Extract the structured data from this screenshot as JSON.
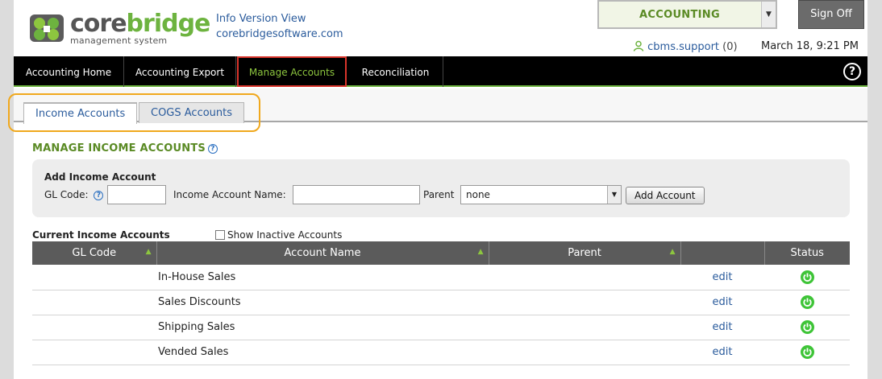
{
  "header": {
    "logo_core": "core",
    "logo_bridge": "bridge",
    "logo_sub": "management system",
    "link_info": "Info Version View",
    "link_site": "corebridgesoftware.com",
    "module": "ACCOUNTING",
    "signoff": "Sign Off",
    "username": "cbms.support",
    "user_count": "(0)",
    "datetime": "March 18, 9:21 PM"
  },
  "nav": {
    "items": [
      "Accounting Home",
      "Accounting Export",
      "Manage Accounts",
      "Reconciliation"
    ],
    "active_index": 2,
    "help": "?"
  },
  "subtabs": [
    "Income Accounts",
    "COGS Accounts"
  ],
  "section": {
    "title": "MANAGE INCOME ACCOUNTS"
  },
  "add_form": {
    "title": "Add Income Account",
    "gl_label": "GL Code:",
    "name_label": "Income Account Name:",
    "parent_label": "Parent",
    "parent_value": "none",
    "button": "Add Account"
  },
  "current": {
    "title": "Current Income Accounts",
    "show_inactive": "Show Inactive Accounts",
    "columns": [
      "GL Code",
      "Account Name",
      "Parent",
      "",
      "Status"
    ],
    "rows": [
      {
        "gl": "",
        "name": "In-House Sales",
        "parent": "",
        "action": "edit"
      },
      {
        "gl": "",
        "name": "Sales Discounts",
        "parent": "",
        "action": "edit"
      },
      {
        "gl": "",
        "name": "Shipping Sales",
        "parent": "",
        "action": "edit"
      },
      {
        "gl": "",
        "name": "Vended Sales",
        "parent": "",
        "action": "edit"
      }
    ]
  },
  "colors": {
    "brand_green": "#6db33f",
    "link_blue": "#2a5b9c",
    "active_outline": "#d9342b",
    "tab_highlight": "#f0a81d",
    "status_on": "#3ec437"
  }
}
